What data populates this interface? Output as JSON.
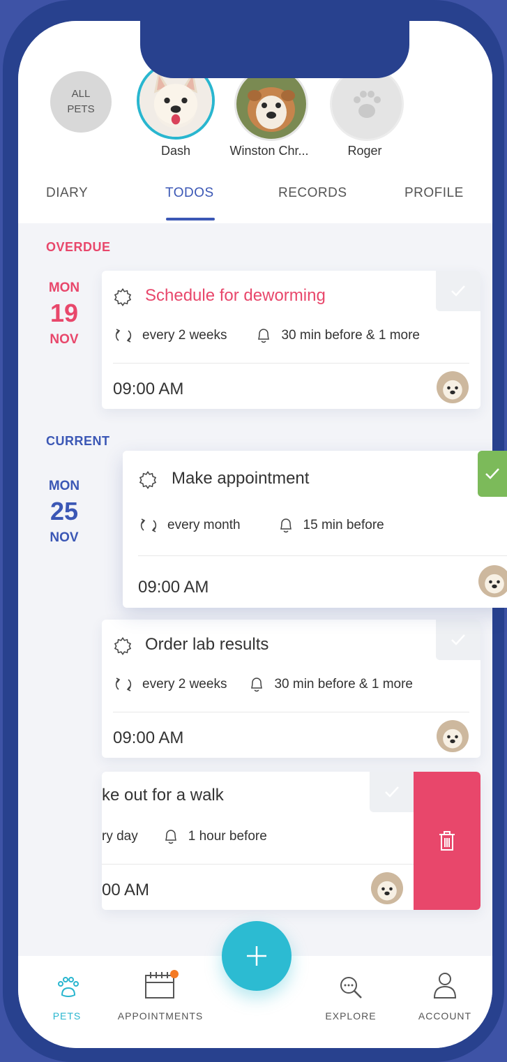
{
  "pets": {
    "all_label": "ALL\nPETS",
    "items": [
      {
        "name": "Dash"
      },
      {
        "name": "Winston Chr..."
      },
      {
        "name": "Roger"
      }
    ]
  },
  "tabs": [
    {
      "label": "DIARY"
    },
    {
      "label": "TODOS"
    },
    {
      "label": "RECORDS"
    },
    {
      "label": "PROFILE"
    }
  ],
  "sections": {
    "overdue": "OVERDUE",
    "current": "CURRENT"
  },
  "dates": [
    {
      "dow": "MON",
      "day": "19",
      "month": "NOV"
    },
    {
      "dow": "MON",
      "day": "25",
      "month": "NOV"
    }
  ],
  "todos": [
    {
      "title": "Schedule for deworming",
      "repeat": "every 2 weeks",
      "reminder": "30 min before & 1 more",
      "time": "09:00 AM"
    },
    {
      "title": "Make appointment",
      "repeat": "every month",
      "reminder": "15 min before",
      "time": "09:00 AM"
    },
    {
      "title": "Order lab results",
      "repeat": "every 2 weeks",
      "reminder": "30 min before & 1 more",
      "time": "09:00 AM"
    },
    {
      "title": "ke out for  a walk",
      "repeat": "ry day",
      "reminder": "1 hour before",
      "time": "00 AM"
    }
  ],
  "nav": {
    "pets": "PETS",
    "appointments": "APPOINTMENTS",
    "explore": "EXPLORE",
    "account": "ACCOUNT"
  },
  "colors": {
    "accent": "#3b57b5",
    "overdue": "#e8476b",
    "fab": "#2cbbd2",
    "done": "#7cba5a",
    "frame": "#28418e"
  },
  "icons": [
    "cog-icon",
    "repeat-icon",
    "bell-icon",
    "check-icon",
    "trash-icon",
    "paw-icon",
    "calendar-icon",
    "search-icon",
    "user-icon",
    "plus-icon"
  ]
}
